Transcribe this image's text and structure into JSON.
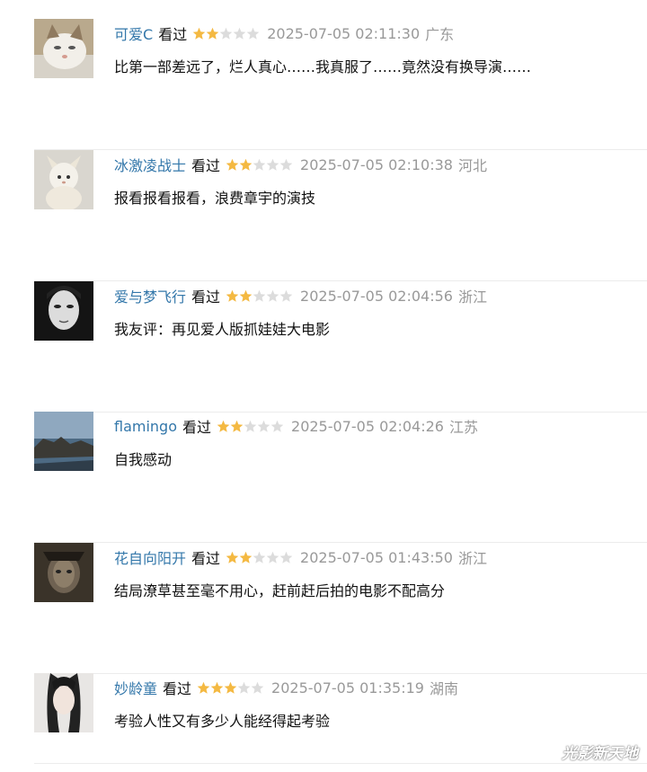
{
  "reviews": [
    {
      "user": "可爱C",
      "status": "看过",
      "rating": 2,
      "time": "2025-07-05 02:11:30",
      "location": "广东",
      "content": "比第一部差远了，烂人真心……我真服了……竟然没有换导演……",
      "avatar": "cat-avatar"
    },
    {
      "user": "冰激凌战士",
      "status": "看过",
      "rating": 2,
      "time": "2025-07-05 02:10:38",
      "location": "河北",
      "content": "报看报看报看，浪费章宇的演技",
      "avatar": "plush-toy-avatar"
    },
    {
      "user": "爱与梦飞行",
      "status": "看过",
      "rating": 2,
      "time": "2025-07-05 02:04:56",
      "location": "浙江",
      "content": "我友评：再见爱人版抓娃娃大电影",
      "avatar": "portrait-avatar"
    },
    {
      "user": "flamingo",
      "status": "看过",
      "rating": 2,
      "time": "2025-07-05 02:04:26",
      "location": "江苏",
      "content": "自我感动",
      "avatar": "seascape-avatar"
    },
    {
      "user": "花自向阳开",
      "status": "看过",
      "rating": 2,
      "time": "2025-07-05 01:43:50",
      "location": "浙江",
      "content": "结局潦草甚至毫不用心，赶前赶后拍的电影不配高分",
      "avatar": "dark-portrait-avatar"
    },
    {
      "user": "妙龄童",
      "status": "看过",
      "rating": 3,
      "time": "2025-07-05 01:35:19",
      "location": "湖南",
      "content": "考验人性又有多少人能经得起考验",
      "avatar": "girl-avatar"
    }
  ],
  "rating_max": 5,
  "colors": {
    "username": "#3377aa",
    "star_on": "#f4b942",
    "star_off": "#dcdcdc",
    "meta": "#999999"
  },
  "watermark": "光影新天地"
}
